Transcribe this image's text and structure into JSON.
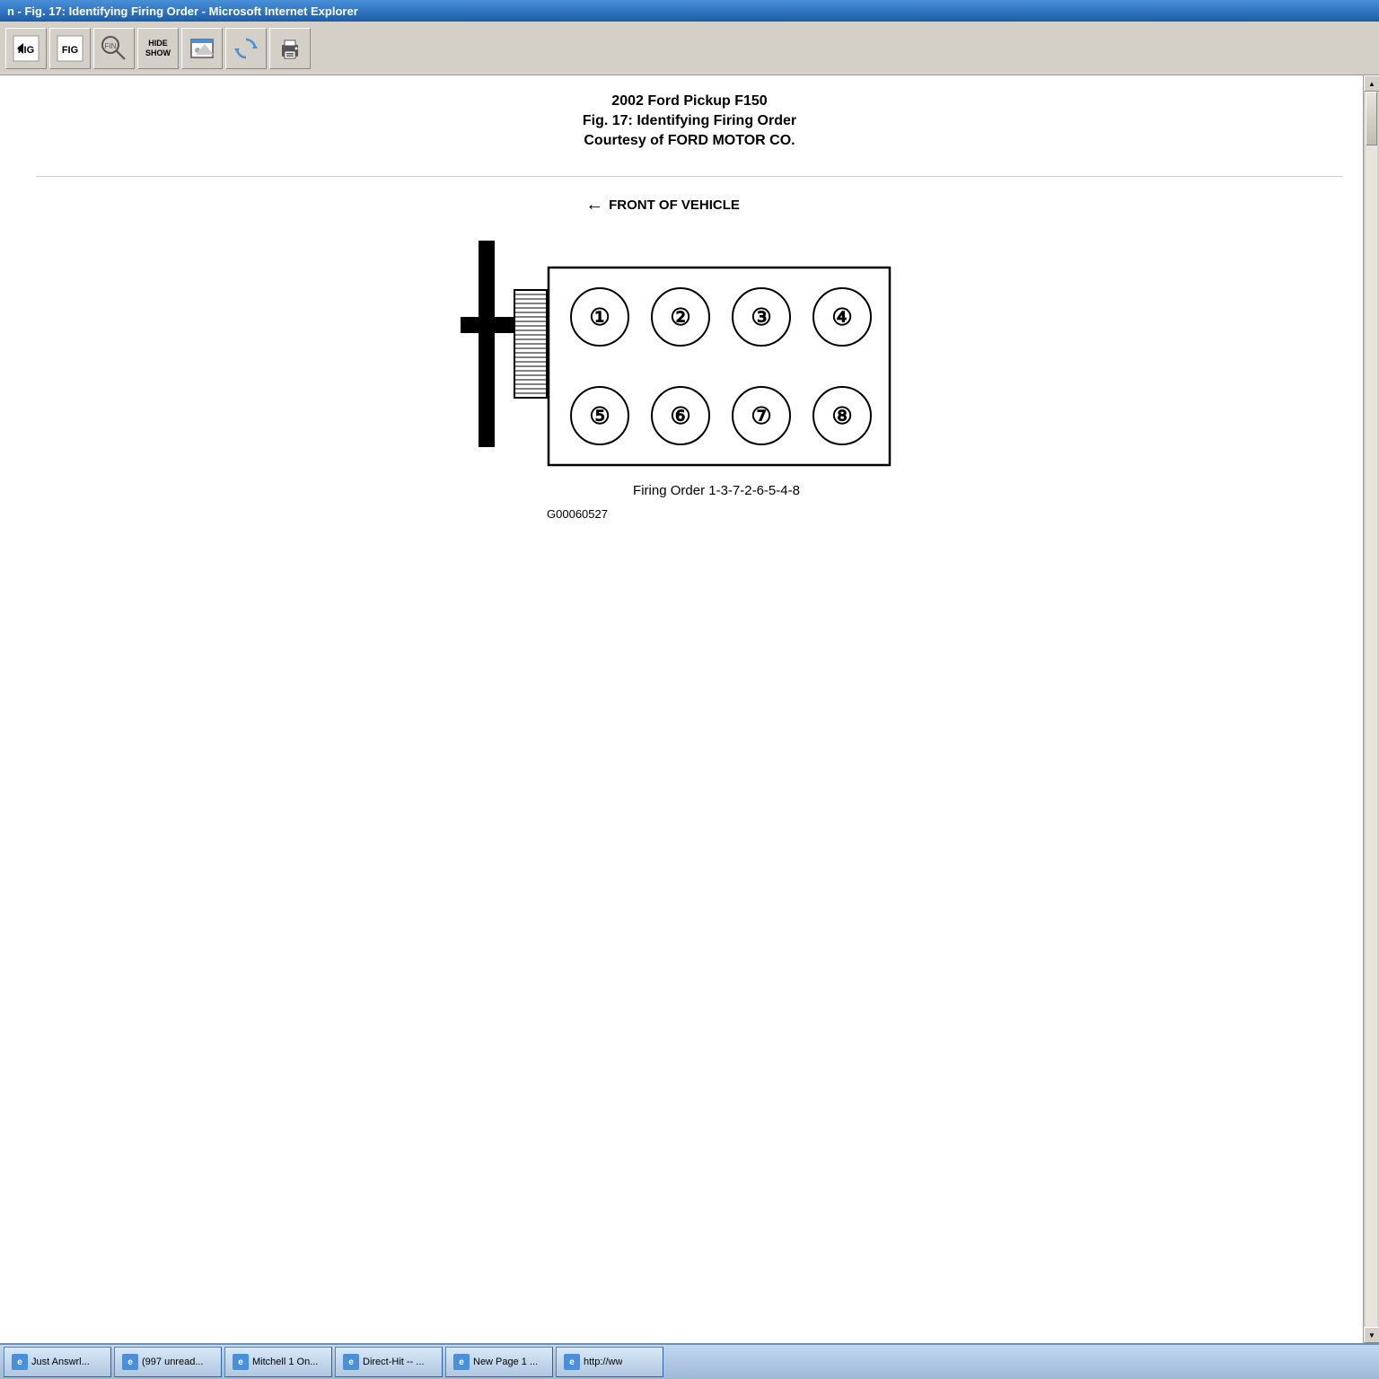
{
  "title_bar": {
    "text": "n - Fig. 17: Identifying Firing Order - Microsoft Internet Explorer"
  },
  "toolbar": {
    "buttons": [
      {
        "label": "FIG",
        "icon": "fig-prev-icon"
      },
      {
        "label": "FIG",
        "icon": "fig-icon"
      },
      {
        "label": "FIND",
        "icon": "find-icon"
      },
      {
        "label": "HIDE\nSHOW",
        "icon": "hide-show-icon"
      },
      {
        "label": "",
        "icon": "image-icon"
      },
      {
        "label": "",
        "icon": "refresh-icon"
      },
      {
        "label": "",
        "icon": "print-icon"
      }
    ]
  },
  "content": {
    "vehicle": "2002 Ford Pickup F150",
    "figure_title": "Fig. 17: Identifying Firing Order",
    "courtesy": "Courtesy of FORD MOTOR CO.",
    "front_label": "FRONT OF VEHICLE",
    "cylinder_numbers": {
      "top_row": [
        "①",
        "②",
        "③",
        "④"
      ],
      "bottom_row": [
        "⑤",
        "⑥",
        "⑦",
        "⑧"
      ]
    },
    "firing_order_label": "Firing Order 1-3-7-2-6-5-4-8",
    "part_number": "G00060527"
  },
  "taskbar": {
    "buttons": [
      {
        "label": "Just Answrl...",
        "icon": "ie-icon"
      },
      {
        "label": "(997 unread...",
        "icon": "ie-icon"
      },
      {
        "label": "Mitchell 1 On...",
        "icon": "ie-icon"
      },
      {
        "label": "Direct-Hit -- ...",
        "icon": "ie-icon"
      },
      {
        "label": "New Page 1 ...",
        "icon": "ie-icon"
      },
      {
        "label": "http://ww",
        "icon": "ie-icon"
      }
    ]
  }
}
